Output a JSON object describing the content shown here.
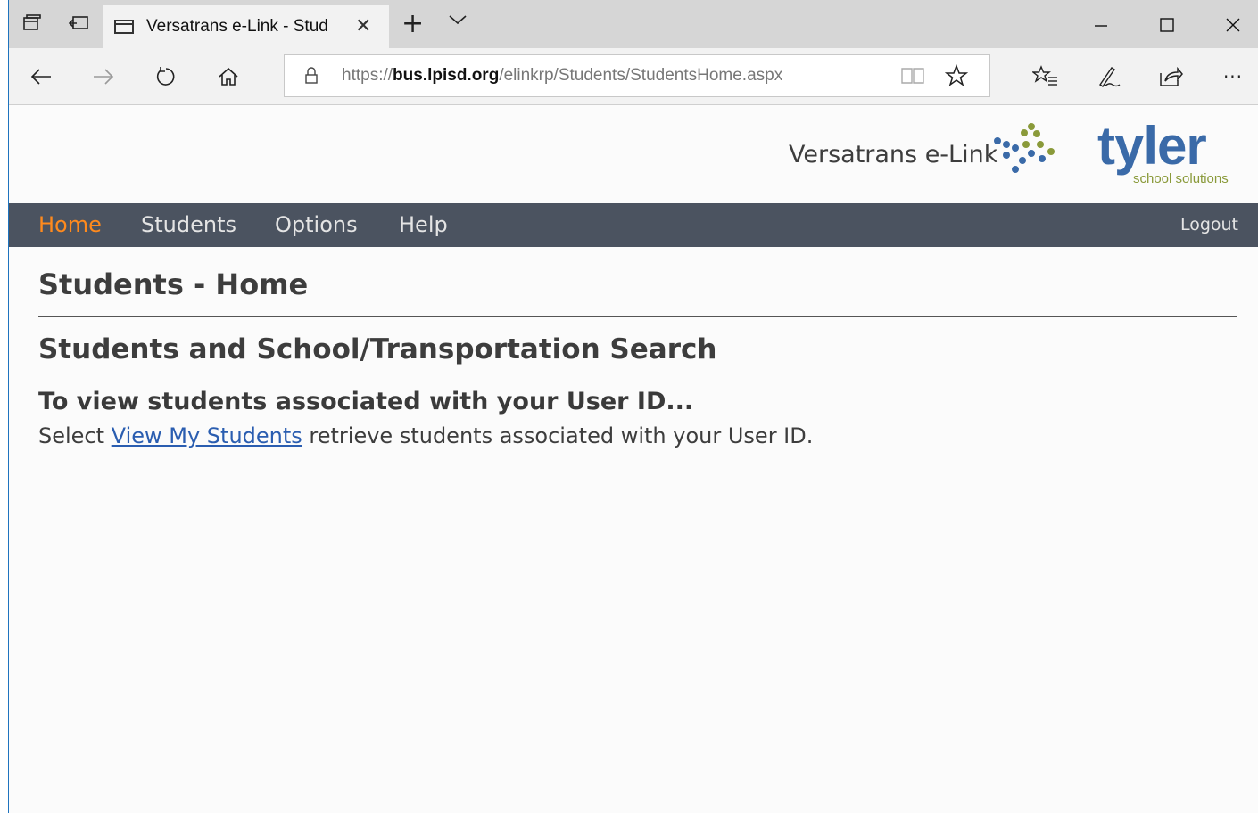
{
  "browser": {
    "tab_title": "Versatrans e-Link - Stud",
    "tab_close": "✕",
    "new_tab": "+",
    "url_scheme": "https://",
    "url_host": "bus.lpisd.org",
    "url_path": "/elinkrp/Students/StudentsHome.aspx",
    "icons": [
      "tab-preview-icon",
      "set-aside-tabs-icon",
      "back-icon",
      "forward-icon",
      "refresh-icon",
      "home-icon",
      "lock-icon",
      "reading-view-icon",
      "favorite-star-icon",
      "favorites-hub-icon",
      "pen-icon",
      "share-icon",
      "more-icon"
    ],
    "more_label": "···"
  },
  "site": {
    "title": "Versatrans e-Link",
    "logo_word": "tyler",
    "logo_sub": "school solutions",
    "logo_colors": {
      "blue": "#3a6aa8",
      "green": "#8a9a3a"
    }
  },
  "menu": {
    "items": [
      {
        "label": "Home",
        "active": true
      },
      {
        "label": "Students",
        "active": false
      },
      {
        "label": "Options",
        "active": false
      },
      {
        "label": "Help",
        "active": false
      }
    ],
    "logout": "Logout",
    "active_color": "#ff8a1d",
    "bg_color": "#4b5360"
  },
  "main": {
    "page_title": "Students - Home",
    "section_title": "Students and School/Transportation Search",
    "instruction_heading": "To view students associated with your User ID...",
    "instruction_prefix": "Select ",
    "instruction_link": "View My Students",
    "instruction_suffix": " retrieve students associated with your User ID."
  }
}
